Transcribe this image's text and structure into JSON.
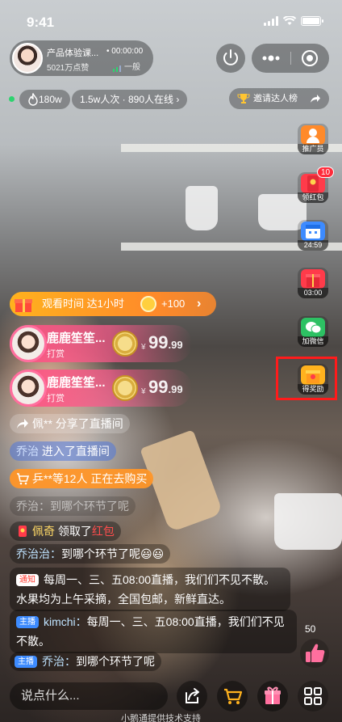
{
  "status": {
    "time": "9:41"
  },
  "anchor": {
    "title": "产品体验课...",
    "duration": "00:00:00",
    "likes": "5021万点赞",
    "network": "一般"
  },
  "stats": {
    "hot": "180w",
    "viewers": "1.5w人次 · 890人在线",
    "invite": "邀请达人榜"
  },
  "tools": [
    {
      "label": "推广员",
      "icon": "promoter-icon",
      "color": "#ff8a2a"
    },
    {
      "label": "领红包",
      "icon": "red-envelope-icon",
      "color": "#ff3b4a",
      "badge": "10"
    },
    {
      "label": "24:59",
      "icon": "calendar-icon",
      "color": "#3d8bff"
    },
    {
      "label": "03:00",
      "icon": "gift-box-icon",
      "color": "#ff3b4a"
    },
    {
      "label": "加微信",
      "icon": "wechat-icon",
      "color": "#2dc163"
    },
    {
      "label": "得奖励",
      "icon": "reward-icon",
      "color": "#ffb21e"
    }
  ],
  "watch_banner": {
    "text": "观看时间 达1小时",
    "reward": "+100"
  },
  "rewards": [
    {
      "name": "鹿鹿笙笙...",
      "action": "打赏",
      "currency": "¥",
      "amount": "99",
      "decimals": ".99"
    },
    {
      "name": "鹿鹿笙笙...",
      "action": "打赏",
      "currency": "¥",
      "amount": "99",
      "decimals": ".99"
    }
  ],
  "chat": {
    "share": "佩** 分享了直播间",
    "enter_name": "乔治",
    "enter_text": " 进入了直播间",
    "shop": "乒**等12人 正在去购买",
    "faint": "乔治：到哪个环节了呢",
    "redpack_name": "佩奇",
    "redpack_text": " 领取了",
    "redpack_hl": "红包",
    "q1_name": "乔治治：",
    "q1_text": "到哪个环节了呢😃😃",
    "notice_tag": "通知",
    "notice_text": "每周一、三、五08:00直播，我们们不见不散。水果均为上午采摘，全国包邮，新鲜直达。",
    "anchor_tag": "主播",
    "anchor_name": "kimchi：",
    "anchor_text": "每周一、三、五08:00直播，我们们不见不散。",
    "q2_tag": "主播",
    "q2_name": "乔治：",
    "q2_text": "到哪个环节了呢"
  },
  "likes_count": "50",
  "input_placeholder": "说点什么...",
  "footer": "小鹅通提供技术支持"
}
